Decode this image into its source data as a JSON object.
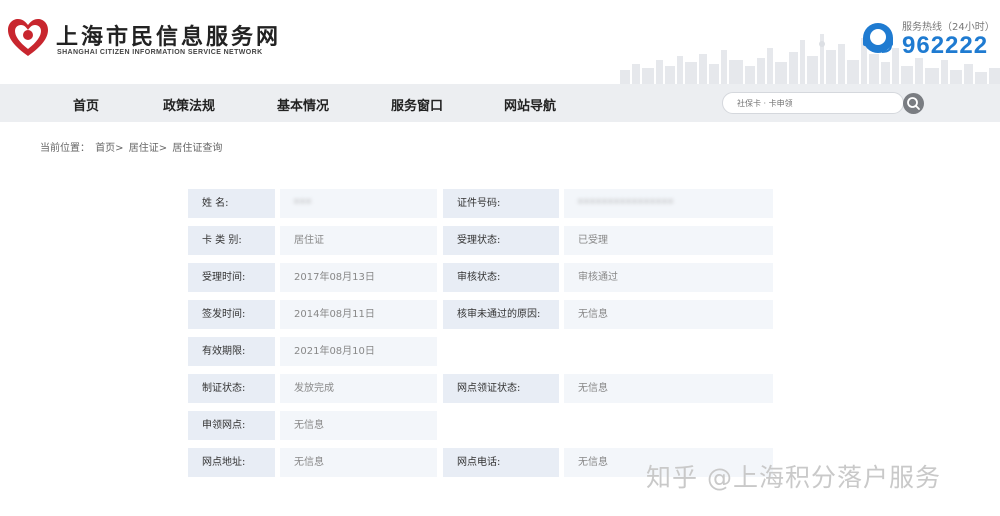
{
  "header": {
    "site_title": "上海市民信息服务网",
    "site_subtitle": "SHANGHAI CITIZEN INFORMATION SERVICE NETWORK",
    "hotline_label": "服务热线（24小时）",
    "hotline_number": "962222"
  },
  "nav": {
    "items": [
      "首页",
      "政策法规",
      "基本情况",
      "服务窗口",
      "网站导航"
    ],
    "search_placeholder": "社保卡 · 卡申领"
  },
  "breadcrumb": {
    "prefix": "当前位置：",
    "items": [
      "首页>",
      "居住证>",
      "居住证查询"
    ]
  },
  "info": {
    "name_label": "姓 名:",
    "name_value": "***",
    "id_label": "证件号码:",
    "id_value": "****************",
    "card_type_label": "卡 类 别:",
    "card_type_value": "居住证",
    "accept_status_label": "受理状态:",
    "accept_status_value": "已受理",
    "accept_time_label": "受理时间:",
    "accept_time_value": "2017年08月13日",
    "review_status_label": "审核状态:",
    "review_status_value": "审核通过",
    "issue_time_label": "签发时间:",
    "issue_time_value": "2014年08月11日",
    "review_fail_label": "核审未通过的原因:",
    "review_fail_value": "无信息",
    "valid_until_label": "有效期限:",
    "valid_until_value": "2021年08月10日",
    "make_status_label": "制证状态:",
    "make_status_value": "发放完成",
    "pickup_status_label": "网点领证状态:",
    "pickup_status_value": "无信息",
    "apply_point_label": "申领网点:",
    "apply_point_value": "无信息",
    "point_address_label": "网点地址:",
    "point_address_value": "无信息",
    "point_phone_label": "网点电话:",
    "point_phone_value": "无信息"
  },
  "watermark": "知乎 @上海积分落户服务",
  "colors": {
    "hotline_blue": "#1f7bd1",
    "logo_red": "#c8262e",
    "label_bg": "#e8edf5",
    "value_bg": "#f3f6fa",
    "nav_bg": "#eceef1"
  },
  "icons": {
    "logo": "heart-logo-icon",
    "hotline": "headset-icon",
    "search": "search-icon"
  }
}
